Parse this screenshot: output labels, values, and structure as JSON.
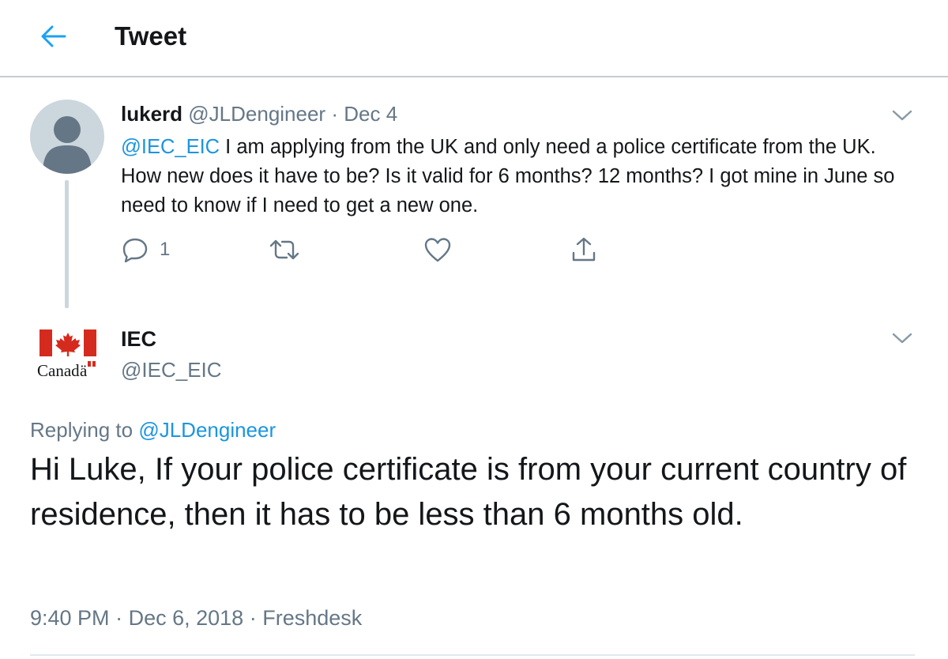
{
  "header": {
    "title": "Tweet",
    "back_icon": "arrow-left-icon"
  },
  "colors": {
    "link": "#1b95e0",
    "secondary_text": "#657786",
    "primary_text": "#14171a",
    "divider": "#c8ccd0"
  },
  "parent_tweet": {
    "author_name": "lukerd",
    "author_handle": "@JLDengineer",
    "separator": "·",
    "date": "Dec 4",
    "mention": "@IEC_EIC",
    "text": " I am applying from the UK and only need a police certificate from the UK. How new does it have to be? Is it valid for 6 months? 12 months? I got mine in June so need to know if I need to get a new one.",
    "reply_count": "1"
  },
  "main_tweet": {
    "author_name": "IEC",
    "author_handle": "@IEC_EIC",
    "logo_text": "Canadä",
    "replying_prefix": "Replying to ",
    "replying_handle": "@JLDengineer",
    "text": "Hi Luke, If your police certificate is from your current country of residence, then it has to be less than 6 months old.",
    "time": "9:40 PM",
    "date": "Dec 6, 2018",
    "source": "Freshdesk",
    "sep": "·"
  }
}
